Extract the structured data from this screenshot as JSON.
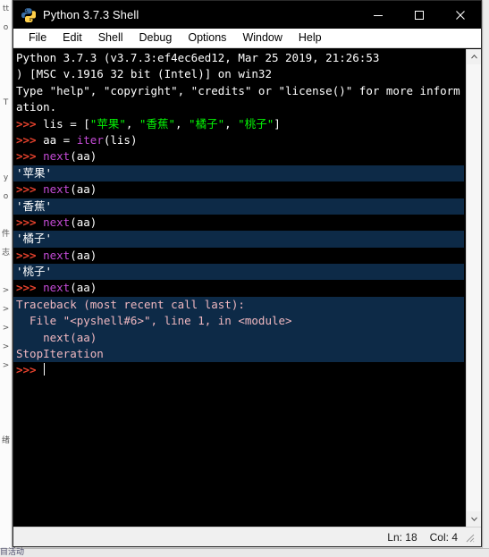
{
  "window": {
    "title": "Python 3.7.3 Shell",
    "icon": "python-logo-icon",
    "controls": {
      "minimize": "minimize-icon",
      "maximize": "maximize-icon",
      "close": "close-icon"
    }
  },
  "menubar": {
    "items": [
      {
        "label": "File"
      },
      {
        "label": "Edit"
      },
      {
        "label": "Shell"
      },
      {
        "label": "Debug"
      },
      {
        "label": "Options"
      },
      {
        "label": "Window"
      },
      {
        "label": "Help"
      }
    ]
  },
  "scrollbar": {
    "up_arrow": "chevron-up-icon",
    "down_arrow": "chevron-down-icon"
  },
  "statusbar": {
    "line_label": "Ln: 18",
    "col_label": "Col: 4"
  },
  "console": {
    "banner": [
      "Python 3.7.3 (v3.7.3:ef4ec6ed12, Mar 25 2019, 21:26:53",
      ") [MSC v.1916 32 bit (Intel)] on win32",
      "Type \"help\", \"copyright\", \"credits\" or \"license()\" for more inform",
      "ation."
    ],
    "prompt": ">>> ",
    "statements": {
      "list_assign_var": "lis = [",
      "list_items": [
        "\"苹果\"",
        "\"香蕉\"",
        "\"橘子\"",
        "\"桃子\""
      ],
      "list_close": "]",
      "list_sep": ", ",
      "iter_assign": "aa = ",
      "iter_call": "iter",
      "iter_args": "(lis)",
      "next_call": "next",
      "next_args": "(aa)"
    },
    "outputs": [
      "'苹果'",
      "'香蕉'",
      "'橘子'",
      "'桃子'"
    ],
    "traceback": [
      "Traceback (most recent call last):",
      "  File \"<pyshell#6>\", line 1, in <module>",
      "    next(aa)",
      "StopIteration"
    ]
  },
  "background": {
    "left_glyphs": "tt\no\n\n\n\nT\n\n\n\ny\no\n\n件\n志\n\n>\n>\n>\n>\n>\n\n\n\n绪",
    "bottom_text": "目活动"
  },
  "colors": {
    "console_bg": "#000000",
    "highlight_bg": "#0d2a47",
    "prompt": "#e8422d",
    "builtin": "#c44bd6",
    "string": "#05f505",
    "error": "#f0b8c0",
    "text": "#ffffff"
  }
}
